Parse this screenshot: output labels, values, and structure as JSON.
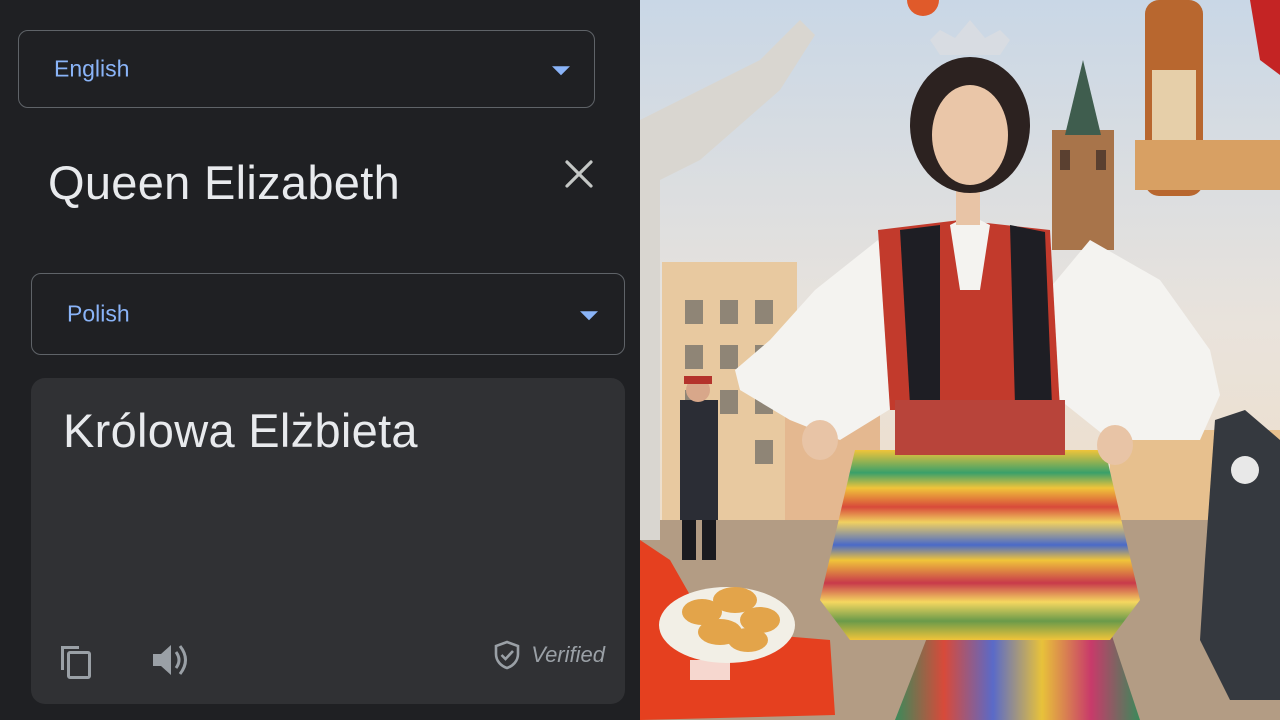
{
  "source_language": {
    "label": "English"
  },
  "source_text": "Queen Elizabeth",
  "target_language": {
    "label": "Polish"
  },
  "translation": {
    "text": "Królowa Elżbieta",
    "verified_label": "Verified"
  },
  "icons": {
    "source_dropdown": "chevron-down-icon",
    "target_dropdown": "chevron-down-icon",
    "clear": "close-icon",
    "copy": "copy-icon",
    "listen": "speaker-icon",
    "verified": "shield-check-icon"
  },
  "colors": {
    "panel_background": "#1f2023",
    "card_background": "#303134",
    "accent": "#8ab4f8",
    "text_primary": "#e8eaed",
    "text_secondary": "#9aa0a6",
    "border": "#5f6368"
  }
}
